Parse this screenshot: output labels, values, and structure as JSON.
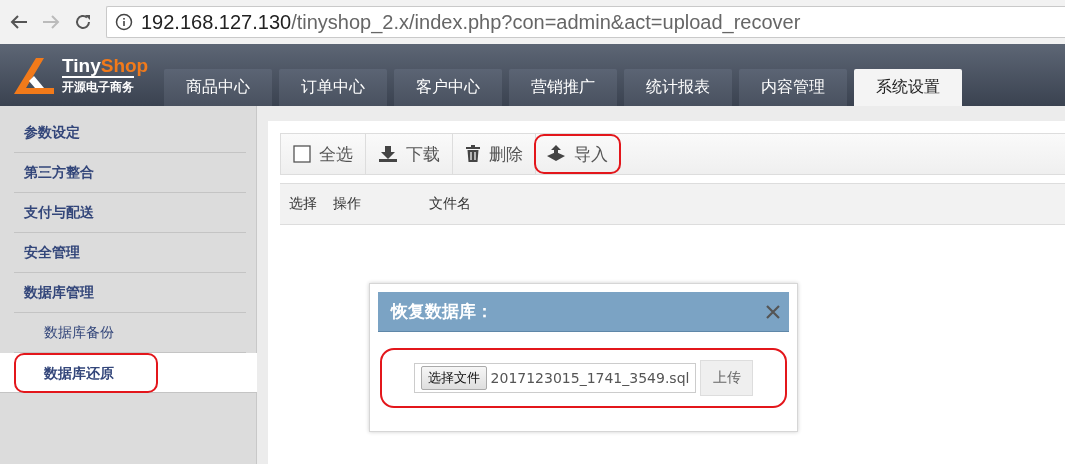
{
  "browser": {
    "url_host": "192.168.127.130",
    "url_path": "/tinyshop_2.x/index.php?con=admin&act=upload_recover"
  },
  "logo": {
    "name_a": "Tiny",
    "name_b": "Shop",
    "tagline": "开源电子商务"
  },
  "tabs": [
    {
      "label": "商品中心",
      "selected": false
    },
    {
      "label": "订单中心",
      "selected": false
    },
    {
      "label": "客户中心",
      "selected": false
    },
    {
      "label": "营销推广",
      "selected": false
    },
    {
      "label": "统计报表",
      "selected": false
    },
    {
      "label": "内容管理",
      "selected": false
    },
    {
      "label": "系统设置",
      "selected": true
    }
  ],
  "sidebar": {
    "items": [
      {
        "label": "参数设定",
        "selected": false,
        "highlighted": false
      },
      {
        "label": "第三方整合",
        "selected": false,
        "highlighted": false
      },
      {
        "label": "支付与配送",
        "selected": false,
        "highlighted": false
      },
      {
        "label": "安全管理",
        "selected": false,
        "highlighted": false
      },
      {
        "label": "数据库管理",
        "selected": false,
        "highlighted": false,
        "children": [
          {
            "label": "数据库备份",
            "selected": false,
            "highlighted": false
          },
          {
            "label": "数据库还原",
            "selected": true,
            "highlighted": true
          }
        ]
      }
    ]
  },
  "toolbar": [
    {
      "kind": "checkbox",
      "label": "全选",
      "highlighted": false
    },
    {
      "kind": "download",
      "label": "下载",
      "highlighted": false
    },
    {
      "kind": "delete",
      "label": "删除",
      "highlighted": false
    },
    {
      "kind": "import",
      "label": "导入",
      "highlighted": true
    }
  ],
  "table": {
    "columns": [
      "选择",
      "操作",
      "文件名"
    ]
  },
  "dialog": {
    "title": "恢复数据库：",
    "choose_button": "选择文件",
    "file_name": "2017123015_1741_3549.sql",
    "upload_button": "上传",
    "highlighted": true
  }
}
